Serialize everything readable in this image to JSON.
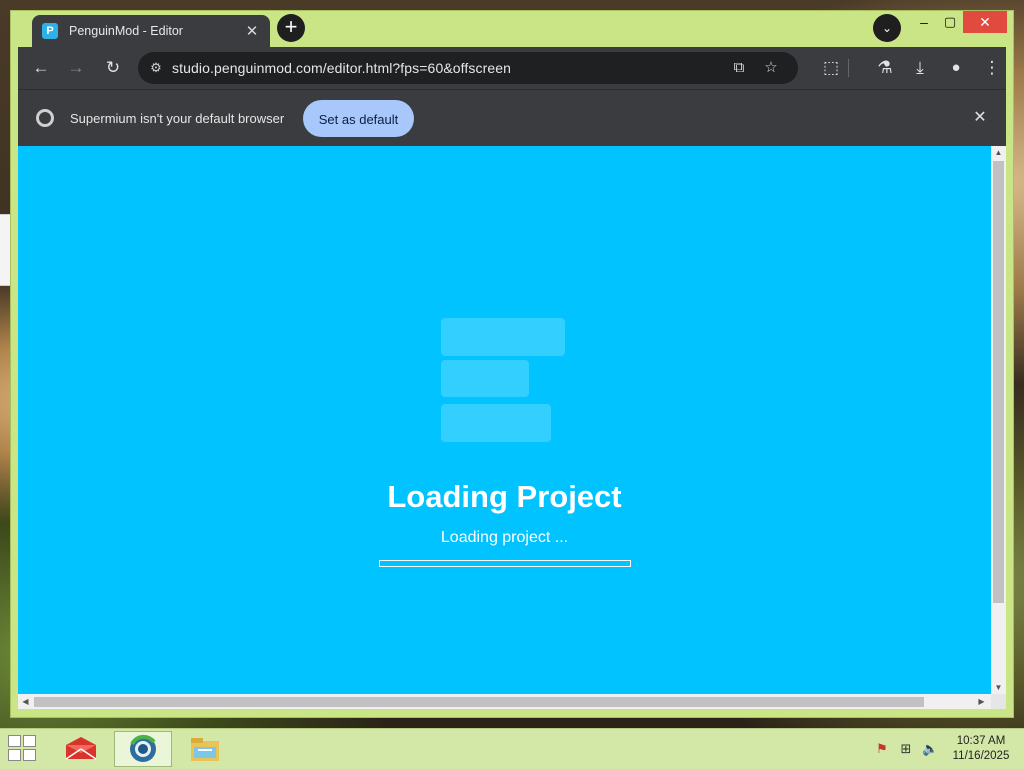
{
  "window": {
    "tab_title": "PenguinMod - Editor",
    "tab_favicon_letter": "P",
    "tab_close_glyph": "✕",
    "new_tab_glyph": "+",
    "tab_search_glyph": "⌄",
    "minimize_glyph": "–",
    "maximize_glyph": "▢",
    "close_glyph": "✕"
  },
  "toolbar": {
    "back_glyph": "←",
    "forward_glyph": "→",
    "reload_glyph": "↻",
    "site_info_glyph": "⚙",
    "url": "studio.penguinmod.com/editor.html?fps=60&offscreen",
    "install_glyph": "⧉",
    "bookmark_glyph": "☆",
    "extensions_glyph": "⬚",
    "labs_glyph": "⚗",
    "downloads_glyph": "⤓",
    "profile_glyph": "●",
    "menu_glyph": "⋮"
  },
  "infobar": {
    "message": "Supermium isn't your default browser",
    "set_default_label": "Set as default",
    "close_glyph": "✕"
  },
  "page": {
    "background_color": "#00c3ff",
    "loading_title": "Loading Project",
    "loading_status": "Loading project ...",
    "progress_fraction": 0
  },
  "scrollbars": {
    "up_glyph": "▲",
    "down_glyph": "▼",
    "left_glyph": "◀",
    "right_glyph": "▶"
  },
  "taskbar": {
    "clock_time": "10:37 AM",
    "clock_date": "11/16/2025",
    "tray_flag_glyph": "⚑",
    "tray_network_glyph": "⊞",
    "tray_volume_glyph": "🔈"
  }
}
